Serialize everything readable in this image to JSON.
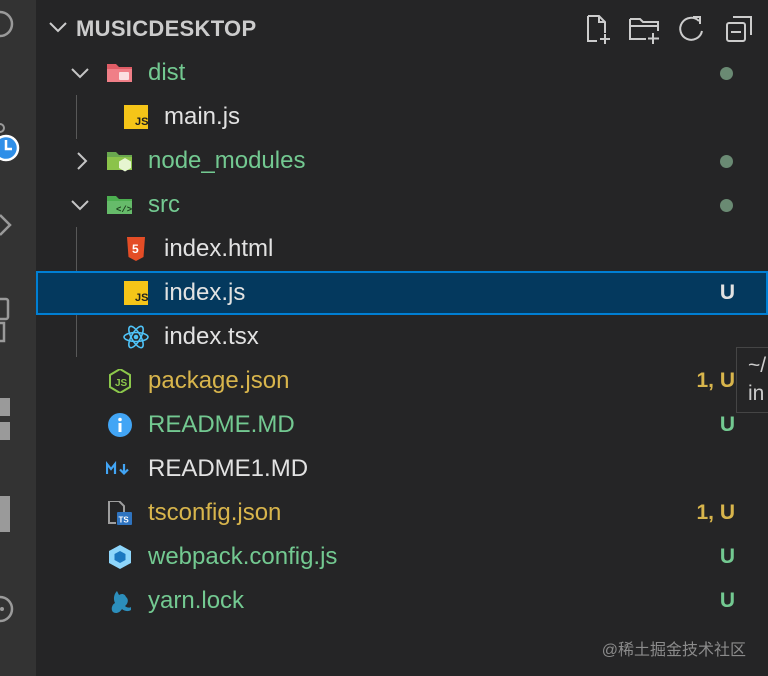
{
  "explorer": {
    "title": "MUSICDESKTOP",
    "actions": [
      "new-file-icon",
      "new-folder-icon",
      "refresh-icon",
      "collapse-all-icon"
    ]
  },
  "tree": [
    {
      "label": "dist",
      "type": "folder",
      "expanded": true,
      "depth": 0,
      "icon": "dist-folder-icon",
      "status": "dot",
      "color": "green"
    },
    {
      "label": "main.js",
      "type": "file",
      "depth": 1,
      "icon": "javascript-icon",
      "status": "",
      "color": "white"
    },
    {
      "label": "node_modules",
      "type": "folder",
      "expanded": false,
      "depth": 0,
      "icon": "node-folder-icon",
      "status": "dot",
      "color": "green"
    },
    {
      "label": "src",
      "type": "folder",
      "expanded": true,
      "depth": 0,
      "icon": "src-folder-icon",
      "status": "dot",
      "color": "green"
    },
    {
      "label": "index.html",
      "type": "file",
      "depth": 1,
      "icon": "html5-icon",
      "status": "",
      "color": "white"
    },
    {
      "label": "index.js",
      "type": "file",
      "depth": 1,
      "icon": "javascript-icon",
      "status": "U",
      "color": "white",
      "selected": true
    },
    {
      "label": "index.tsx",
      "type": "file",
      "depth": 1,
      "icon": "react-icon",
      "status": "",
      "color": "white"
    },
    {
      "label": "package.json",
      "type": "file",
      "depth": 0,
      "icon": "nodejs-icon",
      "status": "1, U",
      "color": "yellow"
    },
    {
      "label": "README.MD",
      "type": "file",
      "depth": 0,
      "icon": "info-icon",
      "status": "U",
      "color": "green"
    },
    {
      "label": "README1.MD",
      "type": "file",
      "depth": 0,
      "icon": "markdown-icon",
      "status": "",
      "color": "white"
    },
    {
      "label": "tsconfig.json",
      "type": "file",
      "depth": 0,
      "icon": "tsconfig-icon",
      "status": "1, U",
      "color": "yellow"
    },
    {
      "label": "webpack.config.js",
      "type": "file",
      "depth": 0,
      "icon": "webpack-icon",
      "status": "U",
      "color": "green"
    },
    {
      "label": "yarn.lock",
      "type": "file",
      "depth": 0,
      "icon": "yarn-icon",
      "status": "U",
      "color": "green"
    }
  ],
  "tooltip": {
    "line1": "~/",
    "line2": "in"
  },
  "watermark": "@稀土掘金技术社区",
  "colors": {
    "sidebar": "#252526",
    "activity_bar": "#333333",
    "selection": "#04395e",
    "selection_border": "#007fd4",
    "git_untracked": "#73c991",
    "git_warning": "#d8b54c"
  }
}
